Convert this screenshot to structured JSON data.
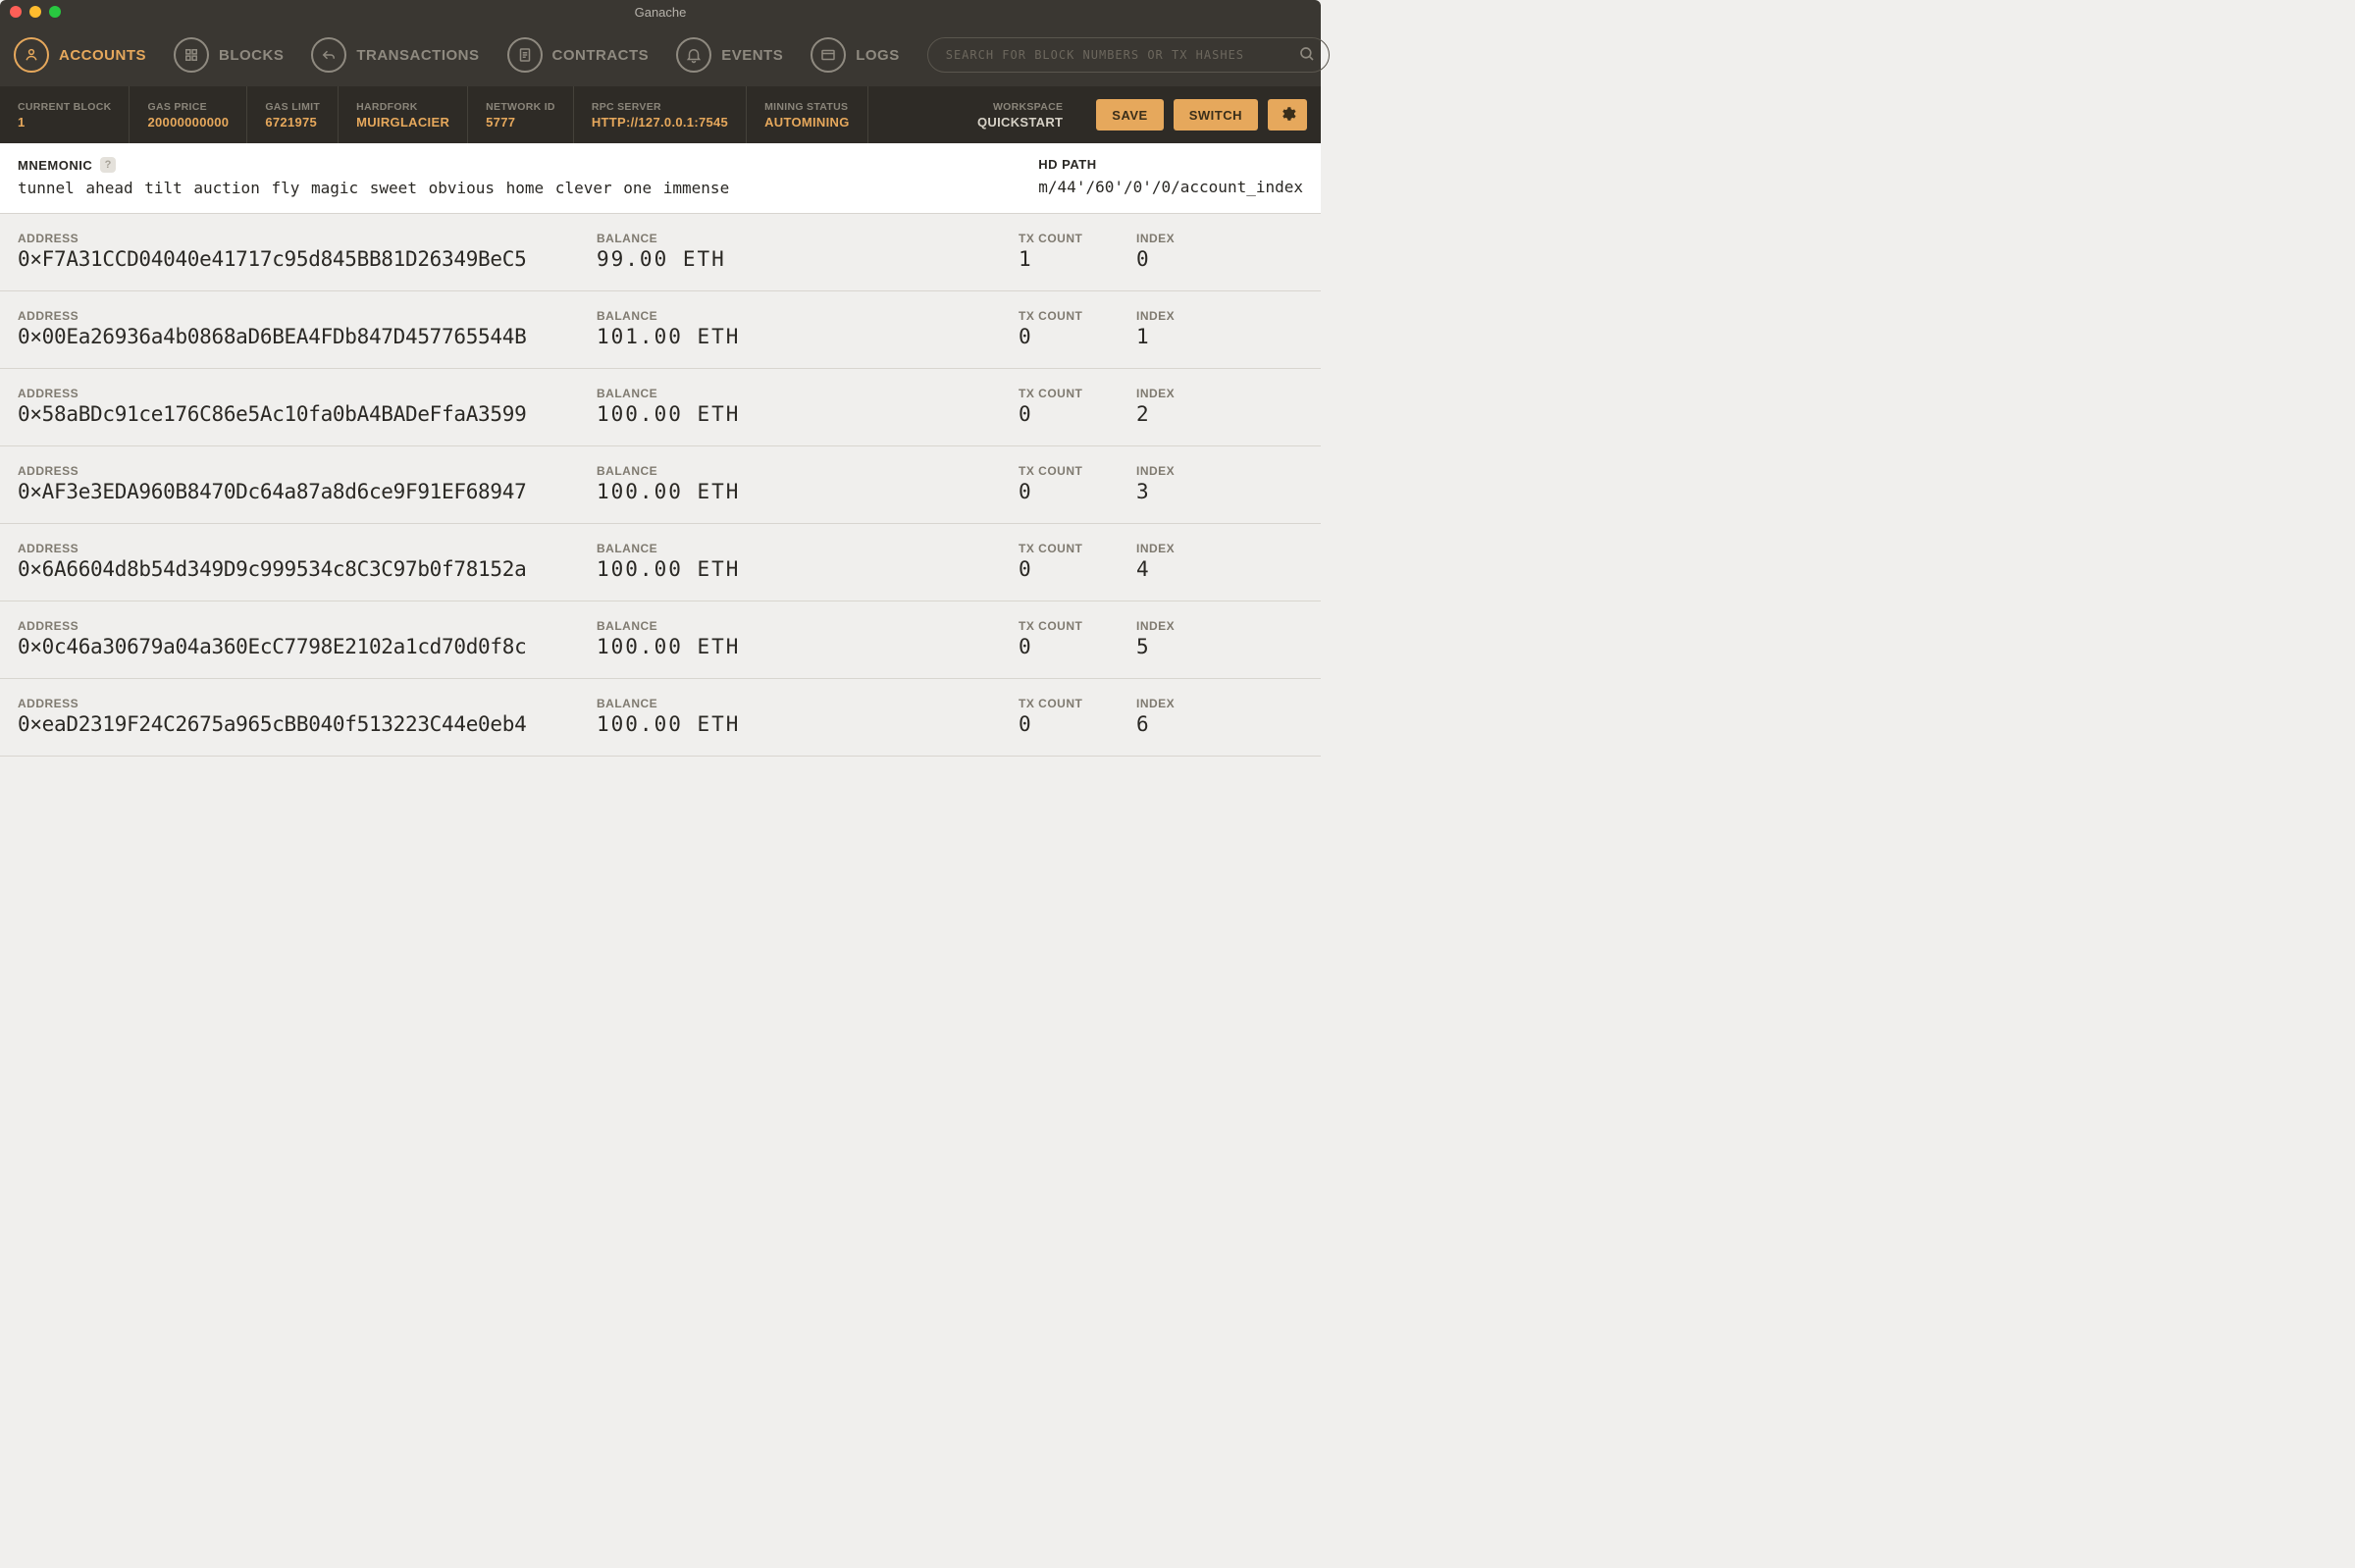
{
  "window": {
    "title": "Ganache"
  },
  "nav": {
    "items": [
      {
        "label": "ACCOUNTS",
        "icon": "user-icon",
        "active": true
      },
      {
        "label": "BLOCKS",
        "icon": "grid-icon",
        "active": false
      },
      {
        "label": "TRANSACTIONS",
        "icon": "arrow-back-icon",
        "active": false
      },
      {
        "label": "CONTRACTS",
        "icon": "document-icon",
        "active": false
      },
      {
        "label": "EVENTS",
        "icon": "bell-icon",
        "active": false
      },
      {
        "label": "LOGS",
        "icon": "card-icon",
        "active": false
      }
    ],
    "search_placeholder": "SEARCH FOR BLOCK NUMBERS OR TX HASHES"
  },
  "status": {
    "items": [
      {
        "label": "CURRENT BLOCK",
        "value": "1"
      },
      {
        "label": "GAS PRICE",
        "value": "20000000000"
      },
      {
        "label": "GAS LIMIT",
        "value": "6721975"
      },
      {
        "label": "HARDFORK",
        "value": "MUIRGLACIER"
      },
      {
        "label": "NETWORK ID",
        "value": "5777"
      },
      {
        "label": "RPC SERVER",
        "value": "HTTP://127.0.0.1:7545"
      },
      {
        "label": "MINING STATUS",
        "value": "AUTOMINING"
      }
    ],
    "workspace": {
      "label": "WORKSPACE",
      "value": "QUICKSTART"
    },
    "save_label": "SAVE",
    "switch_label": "SWITCH"
  },
  "mnemonic": {
    "label": "MNEMONIC",
    "words": "tunnel ahead tilt auction fly magic sweet obvious home clever one immense",
    "hd_label": "HD PATH",
    "hd_value": "m/44'/60'/0'/0/account_index"
  },
  "labels": {
    "address": "ADDRESS",
    "balance": "BALANCE",
    "tx_count": "TX COUNT",
    "index": "INDEX"
  },
  "accounts": [
    {
      "address": "0×F7A31CCD04040e41717c95d845BB81D26349BeC5",
      "balance": "99.00 ETH",
      "tx_count": "1",
      "index": "0"
    },
    {
      "address": "0×00Ea26936a4b0868aD6BEA4FDb847D457765544B",
      "balance": "101.00 ETH",
      "tx_count": "0",
      "index": "1"
    },
    {
      "address": "0×58aBDc91ce176C86e5Ac10fa0bA4BADeFfaA3599",
      "balance": "100.00 ETH",
      "tx_count": "0",
      "index": "2"
    },
    {
      "address": "0×AF3e3EDA960B8470Dc64a87a8d6ce9F91EF68947",
      "balance": "100.00 ETH",
      "tx_count": "0",
      "index": "3"
    },
    {
      "address": "0×6A6604d8b54d349D9c999534c8C3C97b0f78152a",
      "balance": "100.00 ETH",
      "tx_count": "0",
      "index": "4"
    },
    {
      "address": "0×0c46a30679a04a360EcC7798E2102a1cd70d0f8c",
      "balance": "100.00 ETH",
      "tx_count": "0",
      "index": "5"
    },
    {
      "address": "0×eaD2319F24C2675a965cBB040f513223C44e0eb4",
      "balance": "100.00 ETH",
      "tx_count": "0",
      "index": "6"
    }
  ]
}
